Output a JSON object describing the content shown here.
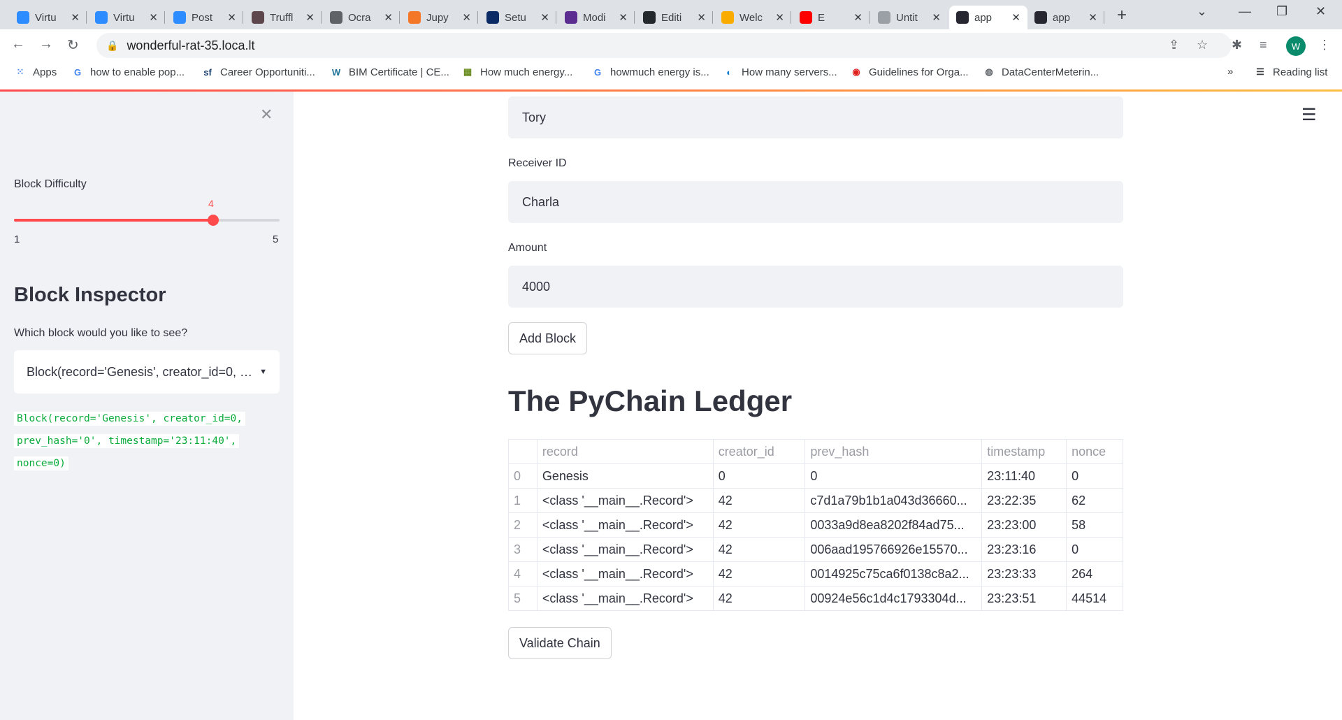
{
  "browser": {
    "tabs": [
      {
        "title": "Virtu",
        "icon": "zoom-icon",
        "color": "#2d8cff"
      },
      {
        "title": "Virtu",
        "icon": "zoom-icon",
        "color": "#2d8cff"
      },
      {
        "title": "Post",
        "icon": "zoom-icon",
        "color": "#2d8cff"
      },
      {
        "title": "Truffl",
        "icon": "truffle-icon",
        "color": "#5e464d"
      },
      {
        "title": "Ocra",
        "icon": "globe-icon",
        "color": "#5f6368"
      },
      {
        "title": "Jupy",
        "icon": "jupyter-icon",
        "color": "#f37726"
      },
      {
        "title": "Setu",
        "icon": "notion-icon",
        "color": "#0a2a66"
      },
      {
        "title": "Modi",
        "icon": "w-icon",
        "color": "#5c2d91"
      },
      {
        "title": "Editi",
        "icon": "github-icon",
        "color": "#24292e"
      },
      {
        "title": "Welc",
        "icon": "co-icon",
        "color": "#f9ab00"
      },
      {
        "title": "E",
        "icon": "youtube-icon",
        "color": "#ff0000"
      },
      {
        "title": "Untit",
        "icon": "colab-icon",
        "color": "#9aa0a6"
      },
      {
        "title": "app",
        "icon": "streamlit-icon",
        "color": "#262730"
      },
      {
        "title": "app",
        "icon": "streamlit-icon",
        "color": "#262730"
      }
    ],
    "url": "wonderful-rat-35.loca.lt",
    "profile_initial": "W",
    "bookmarks": [
      {
        "label": "Apps",
        "icon": "apps-grid-icon"
      },
      {
        "label": "how to enable pop...",
        "icon": "google-icon"
      },
      {
        "label": "Career Opportuniti...",
        "icon": "sf-icon"
      },
      {
        "label": "BIM Certificate | CE...",
        "icon": "wordpress-icon"
      },
      {
        "label": "How much energy...",
        "icon": "image-icon"
      },
      {
        "label": "howmuch energy is...",
        "icon": "google-icon"
      },
      {
        "label": "How many servers...",
        "icon": "edge-icon"
      },
      {
        "label": "Guidelines for Orga...",
        "icon": "red-circle-icon"
      },
      {
        "label": "DataCenterMeterin...",
        "icon": "globe-icon"
      }
    ],
    "more_bookmarks": "»",
    "reading_list": "Reading list"
  },
  "sidebar": {
    "difficulty_label": "Block Difficulty",
    "difficulty_value": "4",
    "difficulty_fraction": 0.75,
    "difficulty_min": "1",
    "difficulty_max": "5",
    "inspector_title": "Block Inspector",
    "inspector_prompt": "Which block would you like to see?",
    "selected_block": "Block(record='Genesis', creator_id=0, prev_hash='0', timestamp='23:11:40', nonce=0)",
    "code_lines": [
      "Block(record='Genesis', creator_id=0,",
      "prev_hash='0', timestamp='23:11:40',",
      "nonce=0)"
    ]
  },
  "form": {
    "sender_value": "Tory",
    "receiver_label": "Receiver ID",
    "receiver_value": "Charla",
    "amount_label": "Amount",
    "amount_value": "4000",
    "add_block_label": "Add Block"
  },
  "ledger": {
    "title": "The PyChain Ledger",
    "columns": [
      "",
      "record",
      "creator_id",
      "prev_hash",
      "timestamp",
      "nonce"
    ],
    "rows": [
      [
        "0",
        "Genesis",
        "0",
        "0",
        "23:11:40",
        "0"
      ],
      [
        "1",
        "<class '__main__.Record'>",
        "42",
        "c7d1a79b1b1a043d36660...",
        "23:22:35",
        "62"
      ],
      [
        "2",
        "<class '__main__.Record'>",
        "42",
        "0033a9d8ea8202f84ad75...",
        "23:23:00",
        "58"
      ],
      [
        "3",
        "<class '__main__.Record'>",
        "42",
        "006aad195766926e15570...",
        "23:23:16",
        "0"
      ],
      [
        "4",
        "<class '__main__.Record'>",
        "42",
        "0014925c75ca6f0138c8a2...",
        "23:23:33",
        "264"
      ],
      [
        "5",
        "<class '__main__.Record'>",
        "42",
        "00924e56c1d4c1793304d...",
        "23:23:51",
        "44514"
      ]
    ],
    "validate_label": "Validate Chain"
  }
}
